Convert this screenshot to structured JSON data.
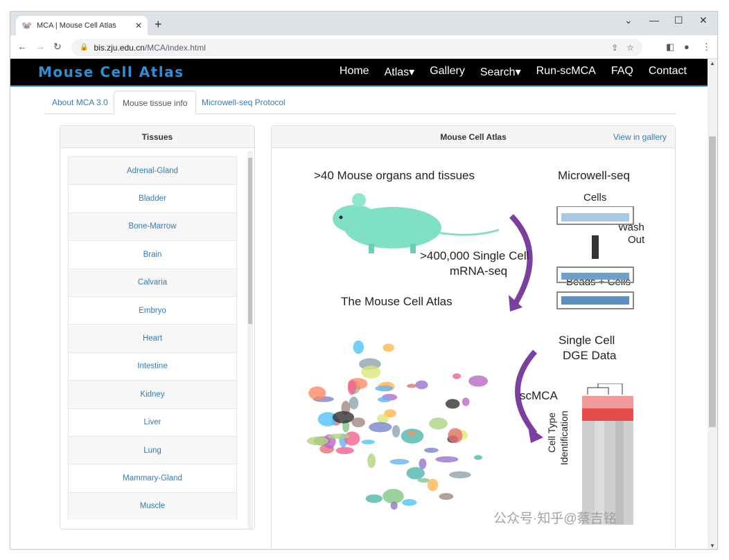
{
  "browser": {
    "tab_title": "MCA | Mouse Cell Atlas",
    "tab_favicon": "🐭",
    "close_tab": "✕",
    "new_tab": "+",
    "url_domain": "bis.zju.edu.cn",
    "url_path": "/MCA/index.html",
    "window_controls": {
      "dropdown": "⌄",
      "minimize": "—",
      "maximize": "☐",
      "close": "✕"
    },
    "nav": {
      "back": "←",
      "forward": "→",
      "reload": "↻"
    }
  },
  "site": {
    "brand": "Mouse Cell Atlas",
    "nav": [
      "Home",
      "Atlas▾",
      "Gallery",
      "Search▾",
      "Run-scMCA",
      "FAQ",
      "Contact"
    ]
  },
  "subtabs": [
    "About MCA 3.0",
    "Mouse tissue info",
    "Microwell-seq Protocol"
  ],
  "active_subtab": "Mouse tissue info",
  "tissues_panel": {
    "title": "Tissues",
    "items": [
      "Adrenal-Gland",
      "Bladder",
      "Bone-Marrow",
      "Brain",
      "Calvaria",
      "Embryo",
      "Heart",
      "Intestine",
      "Kidney",
      "Liver",
      "Lung",
      "Mammary-Gland",
      "Muscle"
    ]
  },
  "atlas_panel": {
    "title": "Mouse Cell Atlas",
    "gallery_link": "View in gallery",
    "figure": {
      "organs": ">40 Mouse organs and tissues",
      "microwell": "Microwell-seq",
      "cells": "Cells",
      "wash": "Wash",
      "out": "Out",
      "single_cell_1": ">400,000 Single Cell",
      "single_cell_2": "mRNA-seq",
      "beads": "Beads + Cells",
      "atlas": "The Mouse Cell Atlas",
      "dge_1": "Single Cell",
      "dge_2": "DGE Data",
      "scmca": "scMCA",
      "cell_type_1": "Cell Type",
      "cell_type_2": "Identification"
    }
  },
  "watermark": "公众号·知乎@蔡吉铭",
  "colors": {
    "brand_blue": "#2f8fd0",
    "link": "#337ab7",
    "navbar": "#000000",
    "mouse": "#7fe0c4",
    "arrow": "#7b3fa0"
  }
}
